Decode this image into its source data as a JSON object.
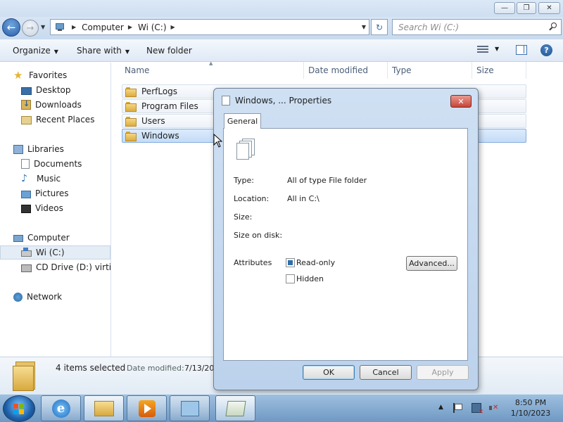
{
  "window": {
    "minimize": "—",
    "maximize": "❐",
    "close": "✕"
  },
  "nav": {
    "back": "←",
    "forward": "→",
    "address": [
      "Computer",
      "Wi (C:)"
    ],
    "refresh": "↻",
    "search_placeholder": "Search Wi (C:)"
  },
  "toolbar": {
    "organize": "Organize",
    "share_with": "Share with",
    "new_folder": "New folder"
  },
  "navpane": {
    "favorites_label": "Favorites",
    "favorites": [
      "Desktop",
      "Downloads",
      "Recent Places"
    ],
    "libraries_label": "Libraries",
    "libraries": [
      "Documents",
      "Music",
      "Pictures",
      "Videos"
    ],
    "computer_label": "Computer",
    "drives": [
      "Wi (C:)",
      "CD Drive (D:) virtio-win"
    ],
    "network_label": "Network"
  },
  "columns": [
    "Name",
    "Date modified",
    "Type",
    "Size"
  ],
  "files": [
    {
      "name": "PerfLogs",
      "selected": true
    },
    {
      "name": "Program Files",
      "selected": true
    },
    {
      "name": "Users",
      "selected": true
    },
    {
      "name": "Windows",
      "selected": true
    }
  ],
  "details": {
    "count": "4 items selected",
    "date_modified_label": "Date modified:",
    "date_modified_value": "7/13/20"
  },
  "dialog": {
    "title": "Windows, ... Properties",
    "close": "✕",
    "tab": "General",
    "type_label": "Type:",
    "type_value": "All of type File folder",
    "location_label": "Location:",
    "location_value": "All in C:\\",
    "size_label": "Size:",
    "size_on_disk_label": "Size on disk:",
    "attributes_label": "Attributes",
    "readonly_label": "Read-only",
    "hidden_label": "Hidden",
    "advanced_button": "Advanced...",
    "ok_button": "OK",
    "cancel_button": "Cancel",
    "apply_button": "Apply",
    "readonly_state": "indeterminate",
    "hidden_state": "unchecked"
  },
  "taskbar": {
    "time": "8:50 PM",
    "date": "1/10/2023"
  },
  "icons": {
    "favorites": "star-icon",
    "network": "network-icon",
    "accent": "#3c72b0"
  }
}
